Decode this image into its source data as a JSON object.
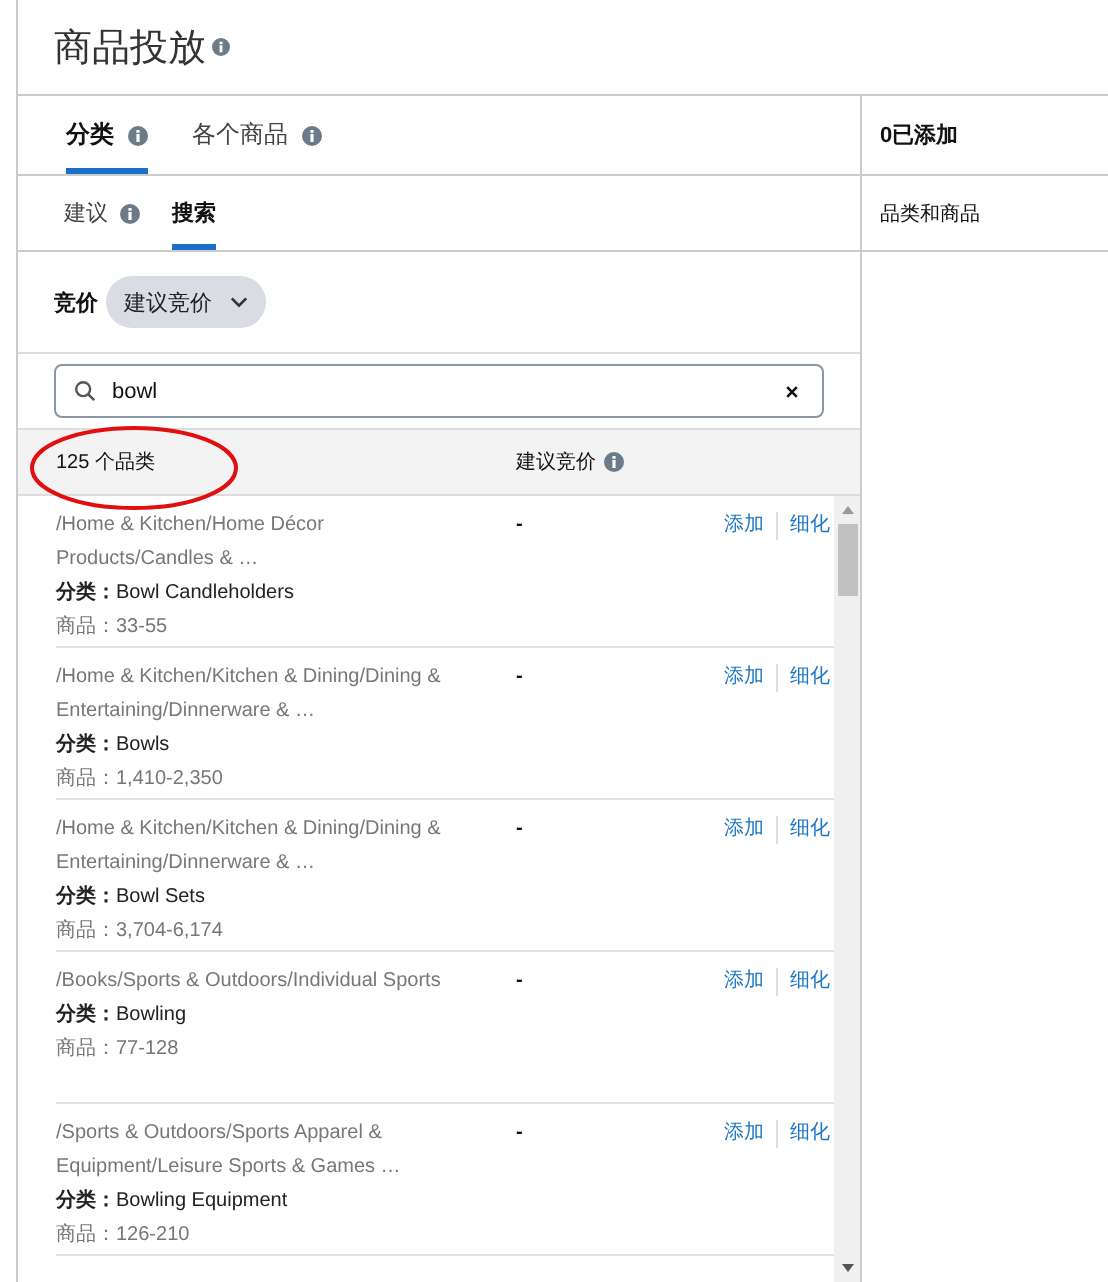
{
  "page": {
    "title": "商品投放"
  },
  "tabs": [
    {
      "label": "分类",
      "selected": true
    },
    {
      "label": "各个商品",
      "selected": false
    }
  ],
  "subtabs": [
    {
      "label": "建议",
      "selected": false,
      "info": true
    },
    {
      "label": "搜索",
      "selected": true,
      "info": false
    }
  ],
  "bid": {
    "label": "竞价",
    "dropdown": "建议竞价"
  },
  "search": {
    "value": "bowl"
  },
  "list": {
    "count": "125 个品类",
    "bid_column": "建议竞价",
    "rows": [
      {
        "path": "/Home & Kitchen/Home Décor Products/Candles & …",
        "category": "**分类：**Bowl Candleholders",
        "products": "商品：33-55",
        "bid": "-",
        "add": "添加",
        "refine": "细化"
      },
      {
        "path": "/Home & Kitchen/Kitchen & Dining/Dining & Entertaining/Dinnerware & …",
        "category": "**分类：**Bowls",
        "products": "商品：1,410-2,350",
        "bid": "-",
        "add": "添加",
        "refine": "细化"
      },
      {
        "path": "/Home & Kitchen/Kitchen & Dining/Dining & Entertaining/Dinnerware & …",
        "category": "**分类：**Bowl Sets",
        "products": "商品：3,704-6,174",
        "bid": "-",
        "add": "添加",
        "refine": "细化"
      },
      {
        "path": "/Books/Sports & Outdoors/Individual Sports",
        "category": "**分类：**Bowling",
        "products": "商品：77-128",
        "bid": "-",
        "add": "添加",
        "refine": "细化"
      },
      {
        "path": "/Sports & Outdoors/Sports Apparel & Equipment/Leisure Sports & Games …",
        "category": "**分类：**Bowling Equipment",
        "products": "商品：126-210",
        "bid": "-",
        "add": "添加",
        "refine": "细化"
      }
    ]
  },
  "added": {
    "title": "0已添加",
    "subtitle": "品类和商品"
  }
}
